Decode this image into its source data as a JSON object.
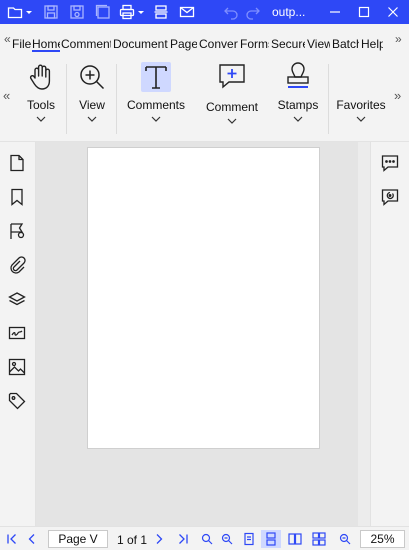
{
  "titlebar": {
    "title": "outp...",
    "accent": "#2e48f6"
  },
  "tabs": [
    {
      "label": "File"
    },
    {
      "label": "Home",
      "active": true
    },
    {
      "label": "Comment"
    },
    {
      "label": "Document"
    },
    {
      "label": "Pages"
    },
    {
      "label": "Convert"
    },
    {
      "label": "Forms"
    },
    {
      "label": "Secure"
    },
    {
      "label": "View"
    },
    {
      "label": "Batch"
    },
    {
      "label": "Help"
    }
  ],
  "ribbon": {
    "tools_label": "Tools",
    "view_label": "View",
    "comments_label": "Comments",
    "comment_label": "Comment",
    "stamps_label": "Stamps",
    "favorites_label": "Favorites"
  },
  "statusbar": {
    "page_value": "Page V",
    "page_of": "1 of 1",
    "zoom": "25%"
  }
}
